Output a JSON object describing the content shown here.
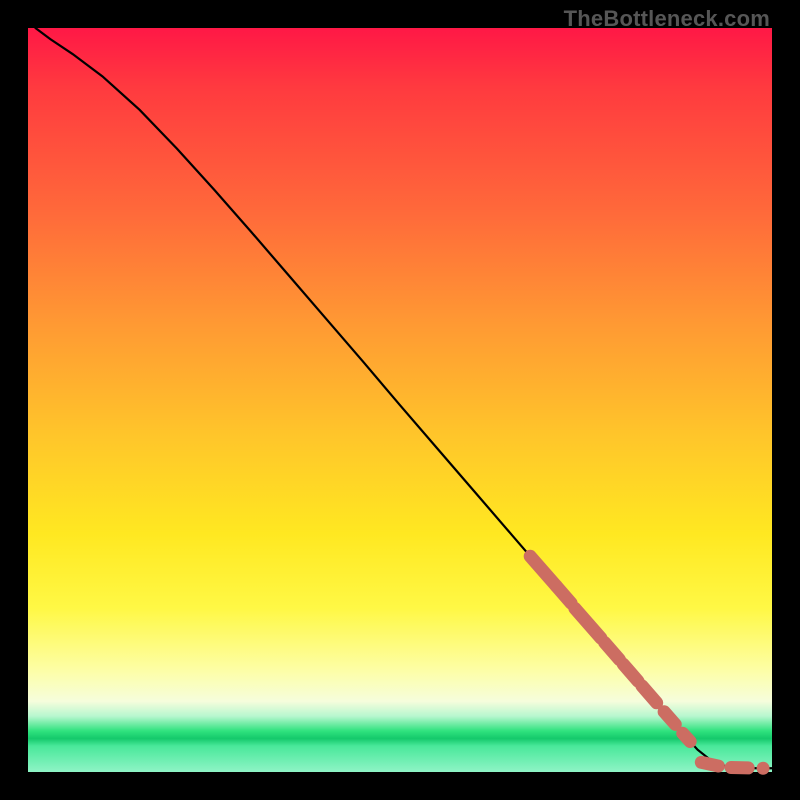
{
  "watermark": "TheBottleneck.com",
  "colors": {
    "curve": "#000000",
    "marker_fill": "#cc6d62",
    "marker_stroke": "#c05a50"
  },
  "chart_data": {
    "type": "line",
    "title": "",
    "xlabel": "",
    "ylabel": "",
    "xlim": [
      0,
      100
    ],
    "ylim": [
      0,
      100
    ],
    "grid": false,
    "series": [
      {
        "name": "curve",
        "x": [
          1,
          3,
          6,
          10,
          15,
          20,
          25,
          30,
          35,
          40,
          45,
          50,
          55,
          60,
          65,
          70,
          75,
          80,
          85,
          88,
          90,
          92,
          94,
          96,
          98,
          100
        ],
        "y": [
          100,
          98.5,
          96.5,
          93.5,
          89,
          83.8,
          78.3,
          72.6,
          66.8,
          61,
          55.2,
          49.3,
          43.5,
          37.7,
          31.9,
          26.1,
          20.3,
          14.5,
          8.7,
          5.2,
          3,
          1.4,
          0.7,
          0.55,
          0.5,
          0.5
        ]
      }
    ],
    "markers": [
      {
        "shape": "segment",
        "x1": 67.5,
        "y1": 29.0,
        "x2": 71.0,
        "y2": 25.0
      },
      {
        "shape": "segment",
        "x1": 71.0,
        "y1": 25.0,
        "x2": 73.0,
        "y2": 22.7
      },
      {
        "shape": "segment",
        "x1": 73.5,
        "y1": 22.0,
        "x2": 77.0,
        "y2": 18.0
      },
      {
        "shape": "segment",
        "x1": 77.5,
        "y1": 17.4,
        "x2": 79.5,
        "y2": 15.1
      },
      {
        "shape": "segment",
        "x1": 80.0,
        "y1": 14.5,
        "x2": 82.0,
        "y2": 12.2
      },
      {
        "shape": "segment",
        "x1": 82.5,
        "y1": 11.6,
        "x2": 84.5,
        "y2": 9.3
      },
      {
        "shape": "segment",
        "x1": 85.5,
        "y1": 8.1,
        "x2": 87.0,
        "y2": 6.4
      },
      {
        "shape": "segment",
        "x1": 88.0,
        "y1": 5.2,
        "x2": 89.0,
        "y2": 4.1
      },
      {
        "shape": "dash",
        "x1": 90.5,
        "y1": 1.3,
        "x2": 92.8,
        "y2": 0.8
      },
      {
        "shape": "dash",
        "x1": 94.5,
        "y1": 0.6,
        "x2": 96.8,
        "y2": 0.55
      },
      {
        "shape": "dot",
        "cx": 98.8,
        "cy": 0.5
      }
    ]
  }
}
